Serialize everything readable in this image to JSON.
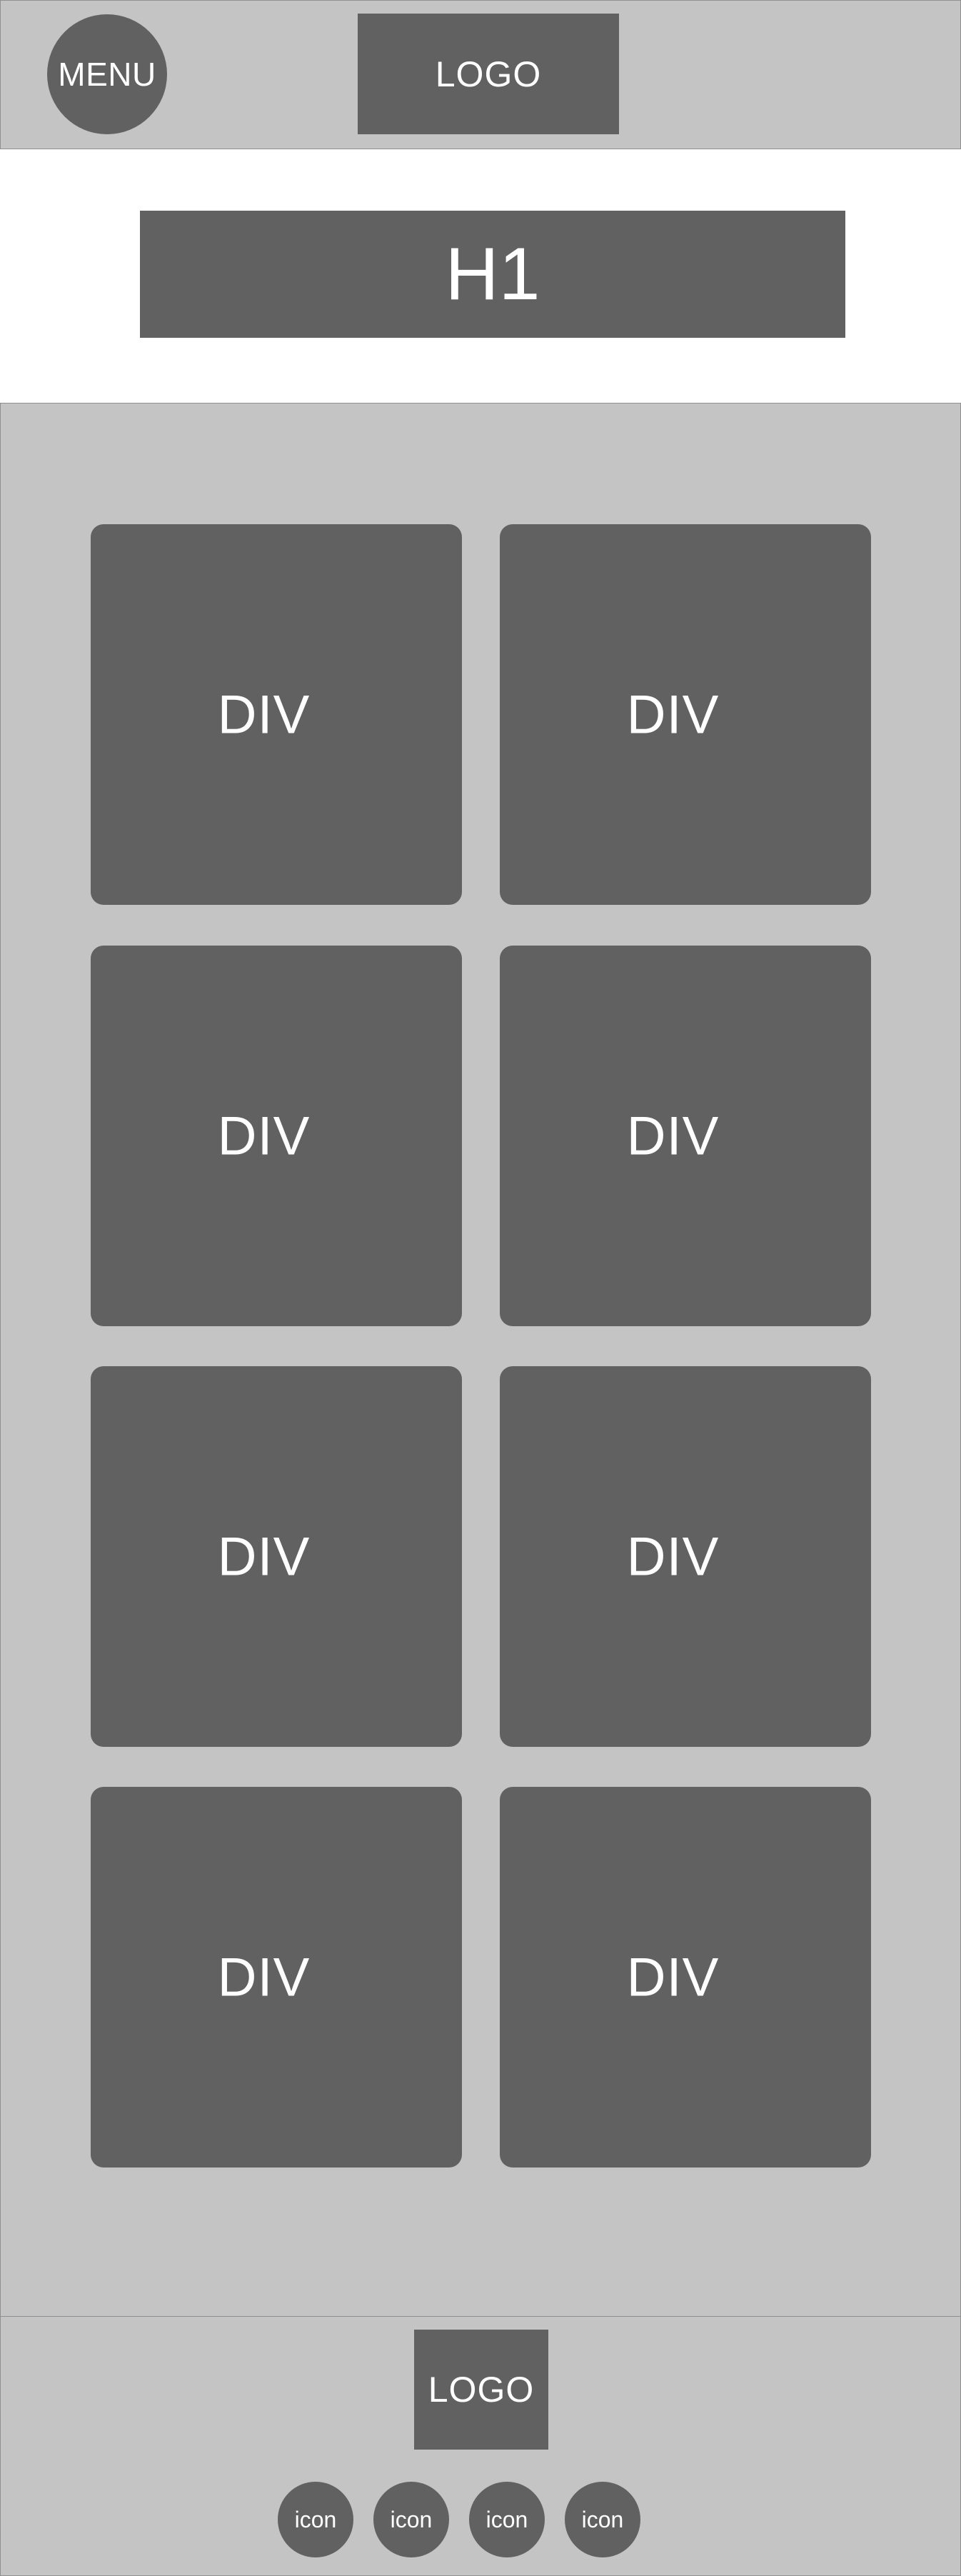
{
  "header": {
    "menu_label": "MENU",
    "logo_label": "LOGO"
  },
  "hero": {
    "title": "H1"
  },
  "grid": {
    "cards": [
      {
        "label": "DIV"
      },
      {
        "label": "DIV"
      },
      {
        "label": "DIV"
      },
      {
        "label": "DIV"
      },
      {
        "label": "DIV"
      },
      {
        "label": "DIV"
      },
      {
        "label": "DIV"
      },
      {
        "label": "DIV"
      }
    ]
  },
  "footer": {
    "logo_label": "LOGO",
    "icons": [
      {
        "label": "icon"
      },
      {
        "label": "icon"
      },
      {
        "label": "icon"
      },
      {
        "label": "icon"
      }
    ]
  },
  "colors": {
    "panel_background": "#c4c4c4",
    "block_fill": "#616161",
    "text": "#ffffff",
    "page_background": "#ffffff"
  }
}
